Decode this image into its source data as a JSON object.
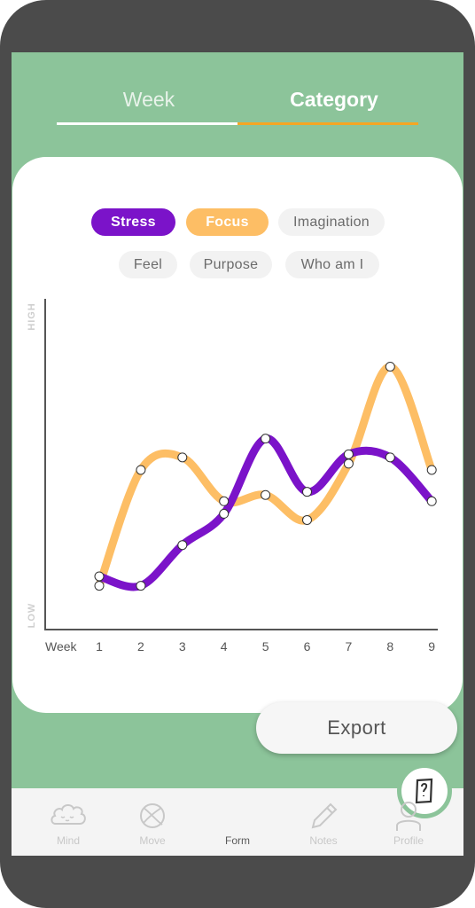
{
  "tabs": {
    "week_label": "Week",
    "category_label": "Category",
    "active": "Category"
  },
  "filters": [
    {
      "label": "Stress",
      "active": true,
      "color": "#7b13c9"
    },
    {
      "label": "Focus",
      "active": true,
      "color": "#fdbe65"
    },
    {
      "label": "Imagination",
      "active": false
    },
    {
      "label": "Feel",
      "active": false
    },
    {
      "label": "Purpose",
      "active": false
    },
    {
      "label": "Who am I",
      "active": false
    }
  ],
  "chart_data": {
    "type": "line",
    "ylabel_high": "HIGH",
    "ylabel_low": "LOW",
    "xlabel": "Week",
    "x": [
      1,
      2,
      3,
      4,
      5,
      6,
      7,
      8,
      9
    ],
    "ylim": [
      0,
      100
    ],
    "series": [
      {
        "name": "Stress",
        "color": "#7b13c9",
        "values": [
          17,
          14,
          27,
          37,
          61,
          44,
          56,
          55,
          41
        ]
      },
      {
        "name": "Focus",
        "color": "#fdbe65",
        "values": [
          14,
          51,
          55,
          41,
          43,
          35,
          53,
          84,
          51
        ]
      }
    ]
  },
  "export_label": "Export",
  "nav": [
    {
      "label": "Mind",
      "icon": "mind-icon",
      "active": false
    },
    {
      "label": "Move",
      "icon": "move-icon",
      "active": false
    },
    {
      "label": "Form",
      "icon": "form-icon",
      "active": true
    },
    {
      "label": "Notes",
      "icon": "notes-icon",
      "active": false
    },
    {
      "label": "Profile",
      "icon": "profile-icon",
      "active": false
    }
  ]
}
